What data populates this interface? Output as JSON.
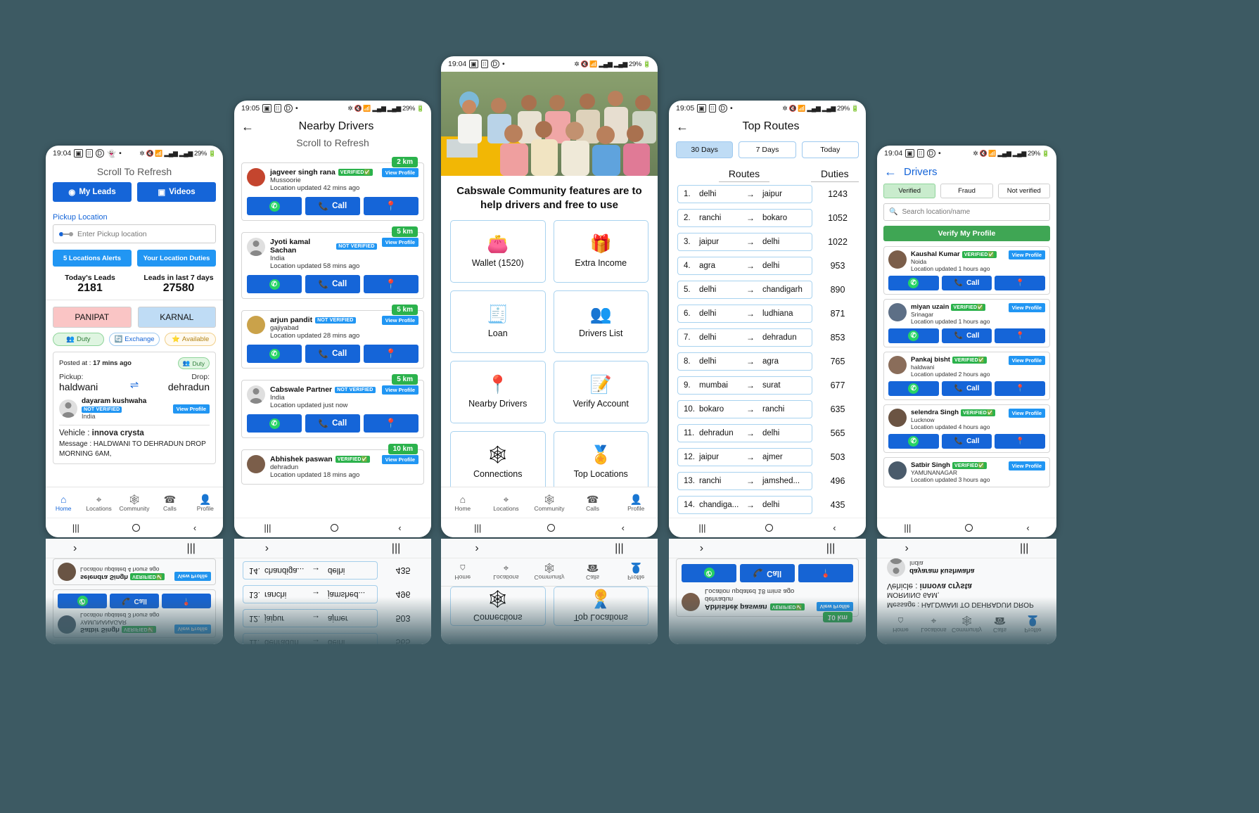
{
  "status_bars": {
    "p1": {
      "time": "19:04",
      "battery": "29%"
    },
    "p2": {
      "time": "19:05",
      "battery": "29%"
    },
    "p3": {
      "time": "19:04",
      "battery": "29%"
    },
    "p4": {
      "time": "19:05",
      "battery": "29%"
    },
    "p5": {
      "time": "19:04",
      "battery": "29%"
    }
  },
  "phone1": {
    "scroll_hint": "Scroll To Refresh",
    "my_leads": "My Leads",
    "videos": "Videos",
    "pickup_label": "Pickup Location",
    "pickup_placeholder": "Enter Pickup location",
    "locations_alerts": "5 Locations Alerts",
    "location_duties": "Your Location Duties",
    "stats": [
      {
        "title": "Today's Leads",
        "value": "2181"
      },
      {
        "title": "Leads in last 7 days",
        "value": "27580"
      }
    ],
    "cities": [
      "PANIPAT",
      "KARNAL"
    ],
    "chips": [
      "Duty",
      "Exchange",
      "Available"
    ],
    "lead": {
      "posted_prefix": "Posted at : ",
      "posted_value": "17 mins ago",
      "badge": "Duty",
      "pickup_label": "Pickup:",
      "drop_label": "Drop:",
      "pickup_value": "haldwani",
      "drop_value": "dehradun",
      "person_name": "dayaram kushwaha",
      "person_badge": "NOT VERIFIED",
      "person_country": "India",
      "view_profile": "View Profile",
      "vehicle_label": "Vehicle : ",
      "vehicle_value": "innova crysta",
      "message": "Message : HALDWANI TO DEHRADUN DROP MORNING 6AM,"
    },
    "bottom_nav": [
      {
        "label": "Home",
        "icon": "home-icon"
      },
      {
        "label": "Locations",
        "icon": "location-icon"
      },
      {
        "label": "Community",
        "icon": "community-icon"
      },
      {
        "label": "Calls",
        "icon": "phone-icon"
      },
      {
        "label": "Profile",
        "icon": "profile-icon"
      }
    ]
  },
  "phone2": {
    "title": "Nearby Drivers",
    "scroll_hint": "Scroll to Refresh",
    "view_profile": "View Profile",
    "call": "Call",
    "drivers": [
      {
        "name": "jagveer singh rana",
        "verified": "VERIFIED",
        "verified_type": "verified",
        "city": "Mussoorie",
        "updated": "Location updated 42 mins ago",
        "km": "2 km"
      },
      {
        "name": "Jyoti kamal Sachan",
        "verified": "NOT VERIFIED",
        "verified_type": "not",
        "city": "India",
        "updated": "Location updated 58 mins ago",
        "km": "5 km"
      },
      {
        "name": "arjun pandit",
        "verified": "NOT VERIFIED",
        "verified_type": "not",
        "city": "gajiyabad",
        "updated": "Location updated 28 mins ago",
        "km": "5 km"
      },
      {
        "name": "Cabswale Partner",
        "verified": "NOT VERIFIED",
        "verified_type": "not",
        "city": "India",
        "updated": "Location updated just now",
        "km": "5 km"
      },
      {
        "name": "Abhishek paswan",
        "verified": "VERIFIED",
        "verified_type": "verified",
        "city": "dehradun",
        "updated": "Location updated 18 mins ago",
        "km": "10 km"
      }
    ]
  },
  "phone3": {
    "headline": "Cabswale Community features are to help drivers and free to use",
    "tiles": [
      {
        "label": "Wallet (1520)",
        "icon": "wallet-icon",
        "glyph": "👛"
      },
      {
        "label": "Extra Income",
        "icon": "gift-icon",
        "glyph": "🎁"
      },
      {
        "label": "Loan",
        "icon": "loan-icon",
        "glyph": "🧾"
      },
      {
        "label": "Drivers List",
        "icon": "people-icon",
        "glyph": "👥"
      },
      {
        "label": "Nearby Drivers",
        "icon": "map-pin-radar-icon",
        "glyph": "📍"
      },
      {
        "label": "Verify Account",
        "icon": "verify-doc-icon",
        "glyph": "📝"
      },
      {
        "label": "Connections",
        "icon": "network-icon",
        "glyph": "🕸"
      },
      {
        "label": "Top Locations",
        "icon": "star-pin-icon",
        "glyph": "🏅"
      }
    ],
    "bottom_nav": [
      {
        "label": "Home",
        "icon": "home-icon"
      },
      {
        "label": "Locations",
        "icon": "location-icon"
      },
      {
        "label": "Community",
        "icon": "community-icon"
      },
      {
        "label": "Calls",
        "icon": "phone-icon"
      },
      {
        "label": "Profile",
        "icon": "profile-icon"
      }
    ]
  },
  "phone4": {
    "title": "Top Routes",
    "tabs": [
      {
        "label": "30 Days",
        "active": true
      },
      {
        "label": "7 Days",
        "active": false
      },
      {
        "label": "Today",
        "active": false
      }
    ],
    "col_routes": "Routes",
    "col_duties": "Duties",
    "routes": [
      {
        "idx": "1.",
        "from": "delhi",
        "to": "jaipur",
        "duties": "1243"
      },
      {
        "idx": "2.",
        "from": "ranchi",
        "to": "bokaro",
        "duties": "1052"
      },
      {
        "idx": "3.",
        "from": "jaipur",
        "to": "delhi",
        "duties": "1022"
      },
      {
        "idx": "4.",
        "from": "agra",
        "to": "delhi",
        "duties": "953"
      },
      {
        "idx": "5.",
        "from": "delhi",
        "to": "chandigarh",
        "duties": "890"
      },
      {
        "idx": "6.",
        "from": "delhi",
        "to": "ludhiana",
        "duties": "871"
      },
      {
        "idx": "7.",
        "from": "delhi",
        "to": "dehradun",
        "duties": "853"
      },
      {
        "idx": "8.",
        "from": "delhi",
        "to": "agra",
        "duties": "765"
      },
      {
        "idx": "9.",
        "from": "mumbai",
        "to": "surat",
        "duties": "677"
      },
      {
        "idx": "10.",
        "from": "bokaro",
        "to": "ranchi",
        "duties": "635"
      },
      {
        "idx": "11.",
        "from": "dehradun",
        "to": "delhi",
        "duties": "565"
      },
      {
        "idx": "12.",
        "from": "jaipur",
        "to": "ajmer",
        "duties": "503"
      },
      {
        "idx": "13.",
        "from": "ranchi",
        "to": "jamshed...",
        "duties": "496"
      },
      {
        "idx": "14.",
        "from": "chandiga...",
        "to": "delhi",
        "duties": "435"
      }
    ]
  },
  "phone5": {
    "title": "Drivers",
    "filters": [
      {
        "label": "Verified",
        "active": true
      },
      {
        "label": "Fraud",
        "active": false
      },
      {
        "label": "Not verified",
        "active": false
      }
    ],
    "search_placeholder": "Search location/name",
    "verify_button": "Verify My Profile",
    "view_profile": "View Profile",
    "call": "Call",
    "drivers": [
      {
        "name": "Kaushal Kumar",
        "badge": "VERIFIED",
        "city": "Noida",
        "updated": "Location updated 1 hours ago"
      },
      {
        "name": "miyan uzain",
        "badge": "VERIFIED",
        "city": "Srinagar",
        "updated": "Location updated 1 hours ago"
      },
      {
        "name": "Pankaj bisht",
        "badge": "VERIFIED",
        "city": "haldwani",
        "updated": "Location updated 2 hours ago"
      },
      {
        "name": "selendra Singh",
        "badge": "VERIFIED",
        "city": "Lucknow",
        "updated": "Location updated 4 hours ago"
      },
      {
        "name": "Satbir Singh",
        "badge": "VERIFIED",
        "city": "YAMUNANAGAR",
        "updated": "Location updated 3 hours ago"
      }
    ]
  },
  "colors": {
    "background": "#3d5a63",
    "primary_blue": "#1565d8",
    "light_blue": "#2196f3",
    "green": "#2bb24c",
    "verify_green": "#3fa654",
    "pink_city": "#fac5c5",
    "blue_city": "#bfdcf5"
  }
}
